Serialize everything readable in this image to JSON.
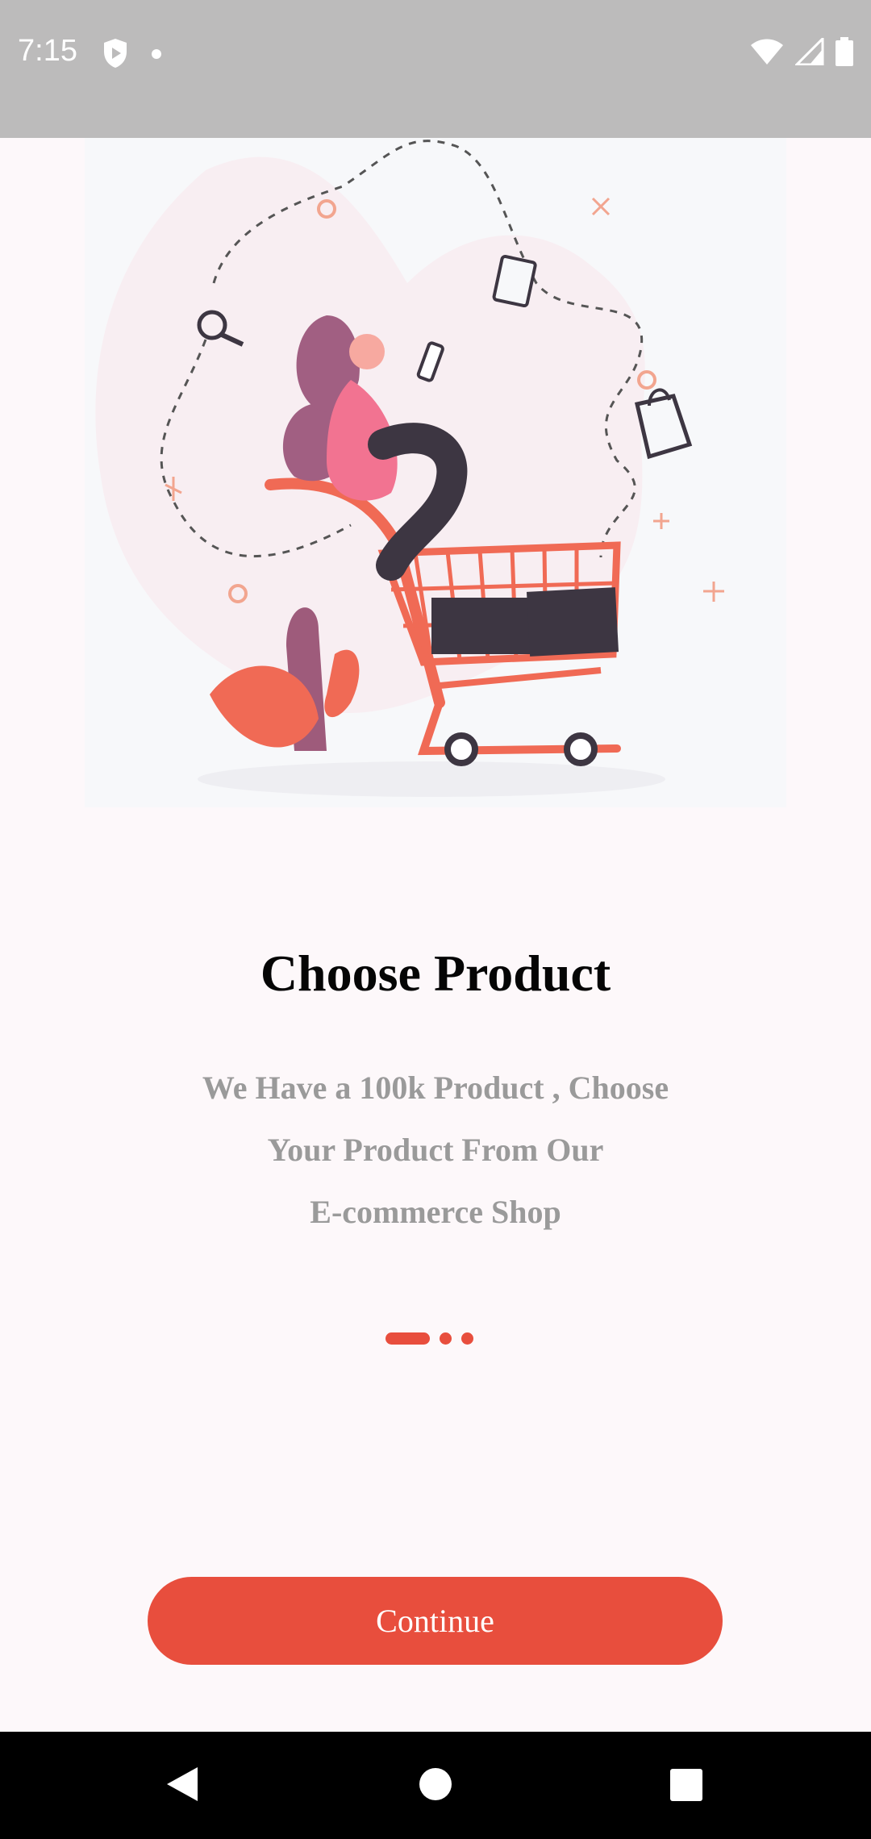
{
  "status_bar": {
    "time": "7:15",
    "icons": [
      "shield-icon",
      "dot-icon",
      "wifi-icon",
      "signal-icon",
      "battery-icon"
    ]
  },
  "onboarding": {
    "title": "Choose Product",
    "subtitle_line1": "We Have a 100k Product , Choose",
    "subtitle_line2": "Your Product From  Our",
    "subtitle_line3": "E-commerce Shop",
    "page_indicator": {
      "current": 1,
      "total": 3
    },
    "continue_label": "Continue"
  },
  "nav_bar": {
    "icons": [
      "back-icon",
      "home-icon",
      "recents-icon"
    ]
  },
  "colors": {
    "accent": "#e84e3d",
    "status_bar": "#bcbbbb",
    "background": "#fdf8fa"
  }
}
